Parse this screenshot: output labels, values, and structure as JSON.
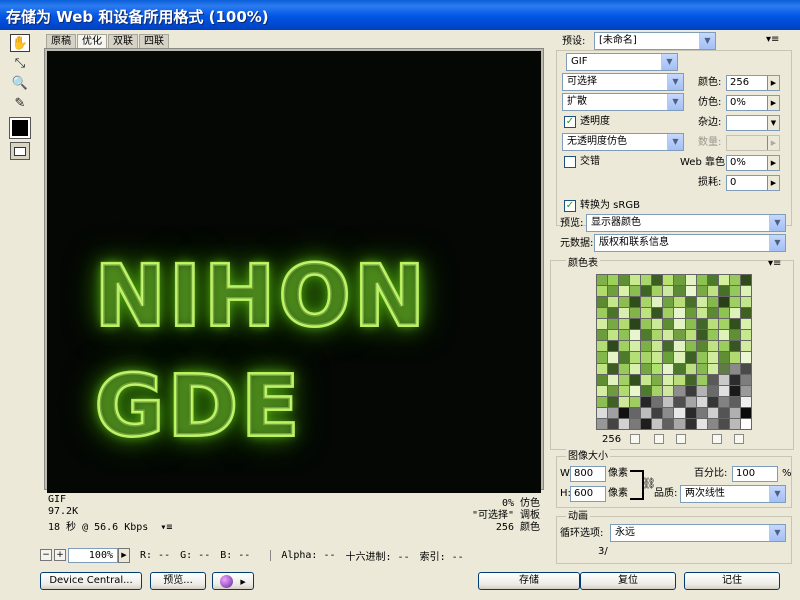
{
  "window": {
    "title": "存储为 Web 和设备所用格式 (100%)"
  },
  "tools": [
    "hand-tool",
    "slice-select-tool",
    "zoom-tool",
    "eyedropper-tool"
  ],
  "tabs": [
    "原稿",
    "优化",
    "双联",
    "四联"
  ],
  "preview": {
    "neon_text": "NIHON GDE",
    "glow_color": "#b6ef5a"
  },
  "info": {
    "format": "GIF",
    "size": "97.2K",
    "time": "18 秒 @ 56.6 Kbps",
    "dither": "0% 仿色",
    "palette_mode": "\"可选择\" 调板",
    "colors": "256 颜色"
  },
  "status": {
    "zoom": "100%",
    "r": "R: --",
    "g": "G: --",
    "b": "B: --",
    "alpha": "Alpha: --",
    "hex": "十六进制: --",
    "index": "索引: --"
  },
  "buttons": {
    "device_central": "Device Central...",
    "preview": "预览...",
    "save": "存储",
    "reset": "复位",
    "remember": "记住"
  },
  "settings": {
    "preset_label": "预设:",
    "preset_value": "[未命名]",
    "format": "GIF",
    "reduction": "可选择",
    "dither_algo": "扩散",
    "transparency_label": "透明度",
    "transparency_checked": true,
    "matte_dither": "无透明度仿色",
    "interlaced_label": "交错",
    "interlaced_checked": false,
    "colors_label": "颜色:",
    "colors_value": "256",
    "dither_label": "仿色:",
    "dither_value": "0%",
    "matte_label": "杂边:",
    "amount_label": "数量:",
    "web_snap_label": "Web 靠色:",
    "web_snap_value": "0%",
    "lossy_label": "损耗:",
    "lossy_value": "0",
    "convert_srgb_label": "转换为 sRGB",
    "convert_srgb_checked": true,
    "preview_label": "预览:",
    "preview_value": "显示器颜色",
    "metadata_label": "元数据:",
    "metadata_value": "版权和联系信息"
  },
  "color_table": {
    "title": "颜色表",
    "count": "256",
    "colors": [
      "#7fb04a",
      "#9bd35a",
      "#5f8f33",
      "#c9e98f",
      "#a7d66c",
      "#3c5e22",
      "#b6e26e",
      "#6f9e3c",
      "#e2f3c0",
      "#8cc24f",
      "#4b7a2a",
      "#d4ef9e",
      "#97c95c",
      "#2f4a1b",
      "#b0dd6a",
      "#6e9f3b",
      "#d8f0a8",
      "#88bf50",
      "#3f6523",
      "#a3d261",
      "#cce9a0",
      "#5a8a32",
      "#e9f6d0",
      "#7aaa45",
      "#bfe382",
      "#466f28",
      "#93c85a",
      "#dbf1b5",
      "#5c8a31",
      "#c4e78a",
      "#8dbd52",
      "#304d1c",
      "#a8d46a",
      "#e0f2bf",
      "#71a240",
      "#b9de78",
      "#496f29",
      "#d1eca0",
      "#86b94c",
      "#2a3f18",
      "#9fcf60",
      "#c3e68c",
      "#9ccc5e",
      "#4a7427",
      "#d9efb0",
      "#82b44a",
      "#bde37e",
      "#36561f",
      "#a1cf64",
      "#e6f5cb",
      "#6b9b39",
      "#c7e891",
      "#5c8932",
      "#8ec354",
      "#dcf2b8",
      "#3e6122",
      "#d3eea1",
      "#78a944",
      "#b2dc70",
      "#2b4419",
      "#96c65a",
      "#cbe996",
      "#5d8d33",
      "#e3f4c4",
      "#8bbd50",
      "#41682a",
      "#b8df7b",
      "#a4d365",
      "#324f1d",
      "#d7f0ac",
      "#6c9c3b",
      "#c0e585",
      "#8fc256",
      "#e8f6cf",
      "#4f7c2c",
      "#a9d66b",
      "#d0eba0",
      "#739f43",
      "#bae07d",
      "#3a5b21",
      "#94c75a",
      "#dff2ba",
      "#609034",
      "#c6e88e",
      "#b4dc74",
      "#2e4a1b",
      "#a0cf62",
      "#d5eea7",
      "#7eaf47",
      "#cae893",
      "#45692a",
      "#e1f3c2",
      "#89bc4f",
      "#5a8631",
      "#bfe382",
      "#9bcd5e",
      "#375622",
      "#d2ec9f",
      "#83b64b",
      "#e4f4c6",
      "#4d7a2c",
      "#b6de77",
      "#a6d468",
      "#c8e891",
      "#6aa03a",
      "#dcf1b6",
      "#3d6023",
      "#91c558",
      "#cfeb9c",
      "#5f8e35",
      "#b1db6f",
      "#eaf7d2",
      "#c1e584",
      "#3b5d21",
      "#98c95b",
      "#d9efae",
      "#74a641",
      "#ade06c",
      "#e5f5c9",
      "#4c7a2b",
      "#bce07f",
      "#87ba4e",
      "#d0ec9f",
      "#617b46",
      "#8a8a8a",
      "#4a4a4a",
      "#5f8d34",
      "#e0f2bd",
      "#a2d063",
      "#344f1e",
      "#c6e78d",
      "#7cad46",
      "#d6efa9",
      "#b8df79",
      "#416526",
      "#9acb5d",
      "#595959",
      "#c9c9c9",
      "#2c2c2c",
      "#7d7d7d",
      "#d3eda2",
      "#6e9c3c",
      "#b0db6e",
      "#e7f6cd",
      "#4e7b2c",
      "#a5d266",
      "#cfe89e",
      "#8e8e8e",
      "#3b3b3b",
      "#b3b3b3",
      "#6a6a6a",
      "#e0e0e0",
      "#1a1a1a",
      "#9a9a9a",
      "#8bbf51",
      "#3f6224",
      "#cce99a",
      "#9ecd60",
      "#262626",
      "#707070",
      "#c2c2c2",
      "#4f4f4f",
      "#a5a5a5",
      "#d8d8d8",
      "#363636",
      "#828282",
      "#5e5e5e",
      "#eeeeee",
      "#dcdcdc",
      "#a0a0a0",
      "#121212",
      "#666666",
      "#bdbdbd",
      "#404040",
      "#8c8c8c",
      "#e8e8e8",
      "#2a2a2a",
      "#787878",
      "#cfcfcf",
      "#545454",
      "#b0b0b0",
      "#0a0a0a",
      "#989898",
      "#444444",
      "#d2d2d2",
      "#7a7a7a",
      "#1e1e1e",
      "#c4c4c4",
      "#606060",
      "#a8a8a8",
      "#303030",
      "#e4e4e4",
      "#888888",
      "#4c4c4c",
      "#bababa",
      "#ffffff"
    ]
  },
  "image_size": {
    "title": "图像大小",
    "w_label": "W:",
    "w_value": "800",
    "h_label": "H:",
    "h_value": "600",
    "unit": "像素",
    "percent_label": "百分比:",
    "percent_value": "100",
    "percent_sign": "%",
    "quality_label": "品质:",
    "quality_value": "两次线性"
  },
  "animation": {
    "title": "动画",
    "loop_label": "循环选项:",
    "loop_value": "永远",
    "frame": "3/"
  }
}
